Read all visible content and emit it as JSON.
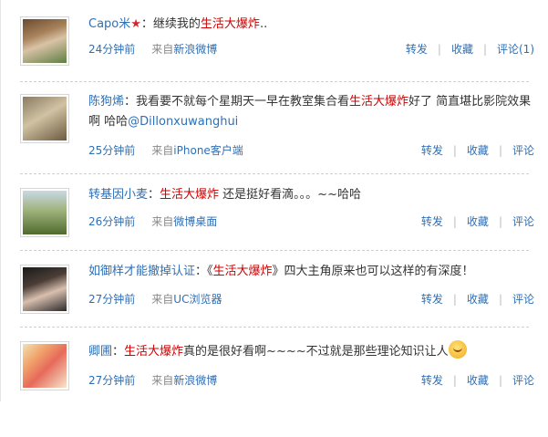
{
  "labels": {
    "from": "来自",
    "sep": "|"
  },
  "posts": [
    {
      "user": "Capo米",
      "text": [
        {
          "t": "：继续我的"
        },
        {
          "t": "生活大爆炸",
          "k": "kw"
        },
        {
          "t": ".."
        }
      ],
      "time": "24分钟前",
      "source": "新浪微博",
      "repost": "转发",
      "favorite": "收藏",
      "comment": "评论(1)",
      "badge_icon": "star-badge-icon",
      "avatar_icon": "user-avatar-icon"
    },
    {
      "user": "陈狗烯",
      "text": [
        {
          "t": "：我看要不就每个星期天一早在教室集合看"
        },
        {
          "t": "生活大爆炸",
          "k": "kw"
        },
        {
          "t": "好了 简直堪比影院效果啊 哈哈"
        },
        {
          "t": "@Dillonxuwanghui",
          "k": "mention"
        }
      ],
      "time": "25分钟前",
      "source": "iPhone客户端",
      "repost": "转发",
      "favorite": "收藏",
      "comment": "评论",
      "avatar_icon": "user-avatar-icon"
    },
    {
      "user": "转基因小麦",
      "text": [
        {
          "t": "："
        },
        {
          "t": "生活大爆炸",
          "k": "kw"
        },
        {
          "t": " 还是挺好看滴。。。~~哈哈"
        }
      ],
      "time": "26分钟前",
      "source": "微博桌面",
      "repost": "转发",
      "favorite": "收藏",
      "comment": "评论",
      "avatar_icon": "user-avatar-icon"
    },
    {
      "user": "如御样才能撤掉认证",
      "text": [
        {
          "t": "：《"
        },
        {
          "t": "生活大爆炸",
          "k": "kw"
        },
        {
          "t": "》四大主角原来也可以这样的有深度！"
        }
      ],
      "time": "27分钟前",
      "source": "UC浏览器",
      "repost": "转发",
      "favorite": "收藏",
      "comment": "评论",
      "avatar_icon": "user-avatar-icon"
    },
    {
      "user": "卿圃",
      "text": [
        {
          "t": "："
        },
        {
          "t": "生活大爆炸",
          "k": "kw"
        },
        {
          "t": "真的是很好看啊~~~~不过就是那些理论知识让人"
        },
        {
          "t": "",
          "k": "emoji"
        }
      ],
      "time": "27分钟前",
      "source": "新浪微博",
      "repost": "转发",
      "favorite": "收藏",
      "comment": "评论",
      "avatar_icon": "user-avatar-icon",
      "emoji_icon": "sweat-face-emoji-icon"
    }
  ]
}
